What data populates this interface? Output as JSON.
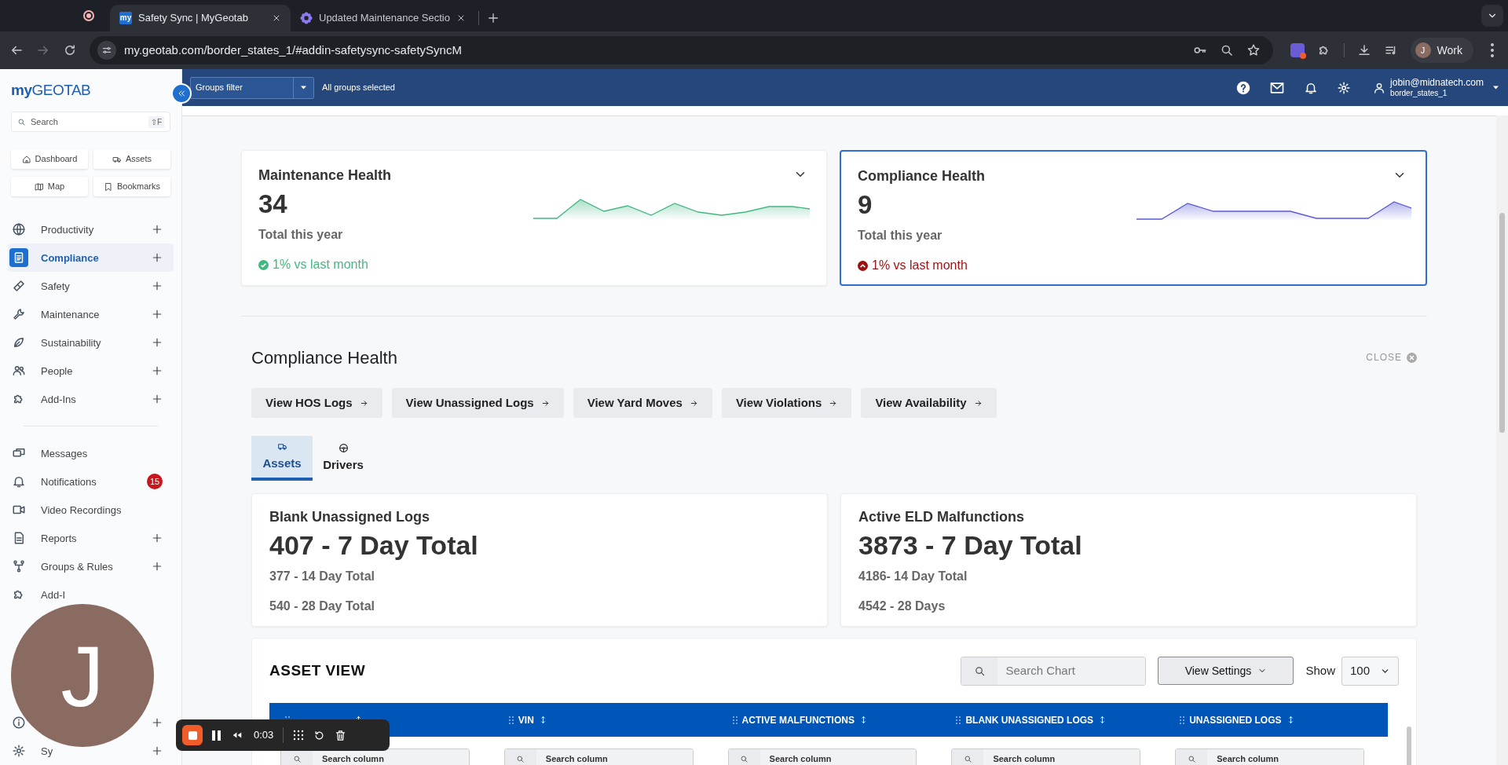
{
  "browser": {
    "tabs": [
      {
        "title": "Safety Sync | MyGeotab",
        "favicon": "my",
        "selected": true
      },
      {
        "title": "Updated Maintenance Sectio",
        "selected": false
      }
    ],
    "url": "my.geotab.com/border_states_1/#addin-safetysync-safetySyncM",
    "profile": {
      "initial": "J",
      "label": "Work"
    }
  },
  "header": {
    "groups_filter": {
      "label": "Groups filter",
      "value": "All groups selected"
    },
    "user": {
      "email": "jobin@midnatech.com",
      "database": "border_states_1"
    }
  },
  "sidebar": {
    "logo": "**my**GEOTAB",
    "search": {
      "placeholder": "Search",
      "shortcut": "⇧F"
    },
    "quick_links": [
      "Dashboard",
      "Assets",
      "Map",
      "Bookmarks"
    ],
    "sections": [
      [
        {
          "label": "Productivity",
          "expandable": true,
          "selected": false
        },
        {
          "label": "Compliance",
          "expandable": true,
          "selected": true
        },
        {
          "label": "Safety",
          "expandable": true,
          "selected": false
        },
        {
          "label": "Maintenance",
          "expandable": true,
          "selected": false
        },
        {
          "label": "Sustainability",
          "expandable": true,
          "selected": false
        },
        {
          "label": "People",
          "expandable": true,
          "selected": false
        },
        {
          "label": "Add-Ins",
          "expandable": true,
          "selected": false
        }
      ],
      [
        {
          "label": "Messages",
          "expandable": false,
          "selected": false
        },
        {
          "label": "Notifications",
          "expandable": false,
          "selected": false,
          "badge": "15"
        },
        {
          "label": "Video Recordings",
          "expandable": false,
          "selected": false
        },
        {
          "label": "Reports",
          "expandable": true,
          "selected": false
        },
        {
          "label": "Groups & Rules",
          "expandable": true,
          "selected": false
        },
        {
          "label": "Add-I",
          "expandable": false,
          "selected": false
        }
      ],
      [
        {
          "expandable": true,
          "selected": false
        },
        {
          "label": "Sy",
          "expandable": true,
          "selected": false
        }
      ]
    ]
  },
  "health_cards": [
    {
      "title": "Maintenance Health",
      "value": "34",
      "caption": "Total this year",
      "trend": "1% vs last month",
      "kind": "good",
      "selected": false
    },
    {
      "title": "Compliance Health",
      "value": "9",
      "caption": "Total this year",
      "trend": "1% vs last month",
      "kind": "bad",
      "selected": true
    }
  ],
  "section": {
    "title": "Compliance Health",
    "close": "CLOSE",
    "links": [
      "View HOS Logs",
      "View Unassigned Logs",
      "View Yard Moves",
      "View Violations",
      "View Availability"
    ],
    "tabs": [
      {
        "label": "Assets",
        "selected": true
      },
      {
        "label": "Drivers",
        "selected": false
      }
    ],
    "metrics": [
      {
        "title": "Blank Unassigned Logs",
        "headline": "407 - 7 Day Total",
        "lines": [
          "377 - 14 Day Total",
          "540 - 28 Day Total"
        ]
      },
      {
        "title": "Active ELD Malfunctions",
        "headline": "3873 - 7 Day Total",
        "lines": [
          "4186- 14 Day Total",
          "4542 - 28 Days"
        ]
      }
    ]
  },
  "asset_view": {
    "title": "ASSET VIEW",
    "search": {
      "placeholder": "Search Chart"
    },
    "settings": "View Settings",
    "show_label": "Show",
    "show_value": "100",
    "columns": [
      {
        "filter_placeholder": "Search column"
      },
      {
        "label": "VIN",
        "filter_placeholder": "Search column"
      },
      {
        "label": "ACTIVE MALFUNCTIONS",
        "filter_placeholder": "Search column"
      },
      {
        "label": "BLANK UNASSIGNED LOGS",
        "filter_placeholder": "Search column"
      },
      {
        "label": "UNASSIGNED LOGS",
        "filter_placeholder": "Search column"
      }
    ]
  },
  "overlay": {
    "avatar": "J",
    "recorder": {
      "time": "0:03"
    }
  }
}
